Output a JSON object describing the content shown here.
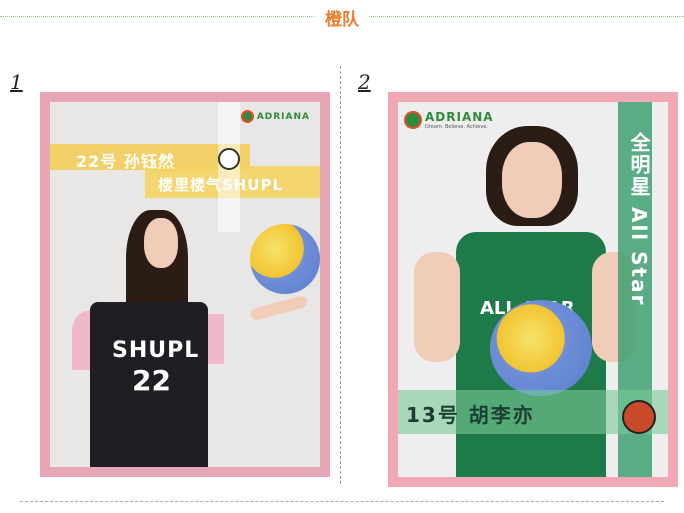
{
  "section": {
    "title": "橙队"
  },
  "cards": [
    {
      "number": "1",
      "band_line1": "22号 孙钰然",
      "band_line2": "楼里楼气SHUPL",
      "jersey": {
        "team": "SHUPL",
        "number": "22"
      },
      "logo": "ADRIANA"
    },
    {
      "number": "2",
      "vertical": "全明星 All Star",
      "name_line": "13号 胡李亦",
      "logo": "ADRIANA",
      "logo_tag": "Dream. Believe. Achieve.",
      "jersey": {
        "team": "ALL STAR"
      }
    }
  ],
  "colors": {
    "accent": "#f07a2a",
    "green": "#3fa073",
    "pink": "#f0a8b4"
  }
}
